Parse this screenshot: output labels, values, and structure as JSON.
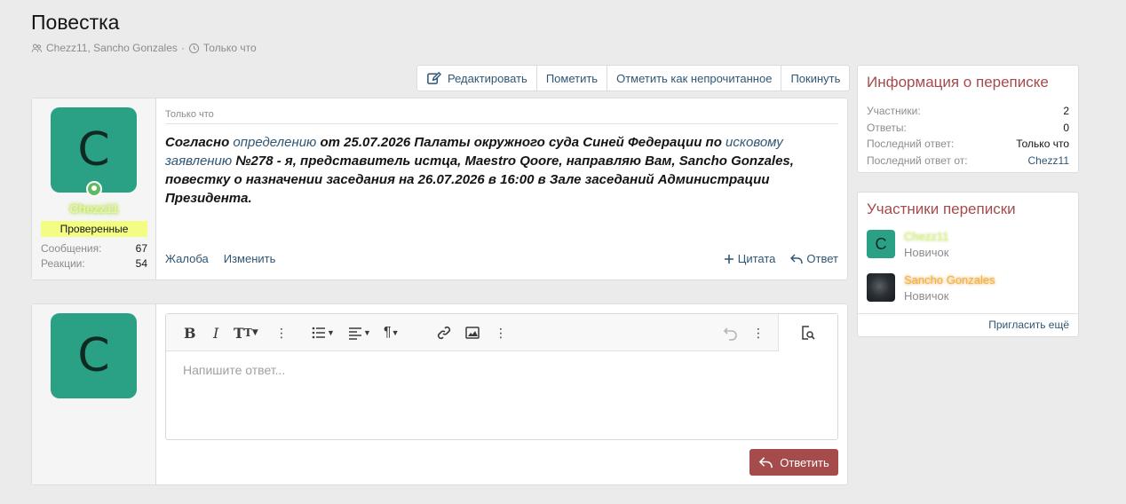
{
  "page": {
    "title": "Повестка",
    "participants_meta": "Chezz11, Sancho Gonzales",
    "time_meta": "Только что"
  },
  "actions": {
    "edit": "Редактировать",
    "mark": "Пометить",
    "mark_unread": "Отметить как непрочитанное",
    "leave": "Покинуть"
  },
  "message": {
    "author_initial": "C",
    "author": "Chezz11",
    "badge": "Проверенные",
    "stats": [
      {
        "label": "Сообщения:",
        "value": "67"
      },
      {
        "label": "Реакции:",
        "value": "54"
      }
    ],
    "time": "Только что",
    "text": {
      "p1": "Согласно ",
      "l1": "определению",
      "p2": " от 25.07.2026 Палаты окружного суда Синей Федерации по ",
      "l2": "исковому заявлению",
      "p3": " №278 - я, представитель истца, Maestro Qoore, направляю Вам, Sancho Gonzales, повестку о назначении заседания на 26.07.2026 в 16:00 в Зале заседаний Администрации Президента."
    },
    "report": "Жалоба",
    "edit": "Изменить",
    "quote": "Цитата",
    "reply": "Ответ"
  },
  "reply_form": {
    "avatar_initial": "C",
    "placeholder": "Напишите ответ...",
    "submit": "Ответить"
  },
  "info_card": {
    "title": "Информация о переписке",
    "rows": [
      {
        "label": "Участники:",
        "value": "2"
      },
      {
        "label": "Ответы:",
        "value": "0"
      },
      {
        "label": "Последний ответ:",
        "value": "Только что"
      },
      {
        "label": "Последний ответ от:",
        "value": "Chezz11"
      }
    ]
  },
  "participants_card": {
    "title": "Участники переписки",
    "participants": [
      {
        "initial": "C",
        "name": "Chezz11",
        "role": "Новичок"
      },
      {
        "name": "Sancho Gonzales",
        "role": "Новичок"
      }
    ],
    "invite": "Пригласить ещё"
  },
  "colors": {
    "accent_red": "#a54b4b",
    "avatar_green": "#2aa184",
    "link": "#2f5675",
    "badge_yellow": "#f3fd84"
  }
}
